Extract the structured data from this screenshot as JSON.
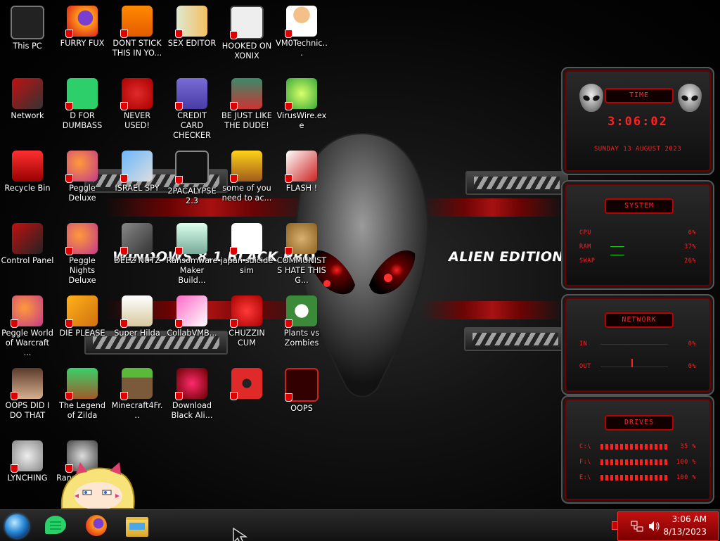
{
  "desktop": {
    "wallpaper_text_left": "WINDOWS 8.1 BLACK PRO",
    "wallpaper_text_right": "ALIEN EDITION 20",
    "icons": [
      {
        "label": "This PC",
        "icon": "monitor-icon"
      },
      {
        "label": "FURRY FUX",
        "icon": "firefox-icon"
      },
      {
        "label": "DONT STICK THIS IN YO...",
        "icon": "vlc-cone-icon"
      },
      {
        "label": "SEX EDITOR",
        "icon": "hex-editor-icon"
      },
      {
        "label": "HOOKED ON XONIX",
        "icon": "xonix-game-icon"
      },
      {
        "label": "VM0Technic...",
        "icon": "doctor-person-icon"
      },
      {
        "label": "Network",
        "icon": "network-icon"
      },
      {
        "label": "D FOR DUMBASS",
        "icon": "green-chat-icon"
      },
      {
        "label": "NEVER USED!",
        "icon": "dev-cpp-icon"
      },
      {
        "label": "CREDIT CARD CHECKER",
        "icon": "credit-card-icon"
      },
      {
        "label": "BE JUST LIKE THE DUDE!",
        "icon": "elf-character-icon"
      },
      {
        "label": "VirusWire.exe",
        "icon": "lime-icon"
      },
      {
        "label": "Recycle Bin",
        "icon": "recycle-bin-icon"
      },
      {
        "label": "Peggle Deluxe",
        "icon": "peggle-icon"
      },
      {
        "label": "ISRAEL SPY",
        "icon": "network-spy-icon"
      },
      {
        "label": "2PACALYPSE 2.3",
        "icon": "terminal-icon"
      },
      {
        "label": "some of you need to ac...",
        "icon": "cartoon-dog-icon"
      },
      {
        "label": "FLASH !",
        "icon": "flash-document-icon"
      },
      {
        "label": "Control Panel",
        "icon": "control-panel-icon"
      },
      {
        "label": "Peggle Nights Deluxe",
        "icon": "peggle-icon"
      },
      {
        "label": "DEEZ NUTZ",
        "icon": "stacked-windows-icon"
      },
      {
        "label": "Ransomware Maker Build...",
        "icon": "app-window-icon"
      },
      {
        "label": "japan suicide sim",
        "icon": "document-icon"
      },
      {
        "label": "COMMUNISTS HATE THIS G...",
        "icon": "money-bag-icon"
      },
      {
        "label": "Peggle World of Warcraft ...",
        "icon": "peggle-icon"
      },
      {
        "label": "DIE PLEASE",
        "icon": "de-app-icon"
      },
      {
        "label": "Super Hilda",
        "icon": "pixel-character-icon"
      },
      {
        "label": "CollabVMB...",
        "icon": "pink-window-icon"
      },
      {
        "label": "CHUZZIN CUM",
        "icon": "red-chuzzle-icon"
      },
      {
        "label": "Plants vs Zombies",
        "icon": "flower-icon"
      },
      {
        "label": "OOPS DID I DO THAT",
        "icon": "portrait-painting-icon"
      },
      {
        "label": "The Legend of Zilda",
        "icon": "pixel-hero-icon"
      },
      {
        "label": "Minecraft4Fr...",
        "icon": "grass-block-icon"
      },
      {
        "label": "Download Black Ali...",
        "icon": "alien-red-icon"
      },
      {
        "label": "",
        "icon": "radiation-icon"
      },
      {
        "label": "OOPS",
        "icon": "red-frame-icon"
      },
      {
        "label": "LYNCHING",
        "icon": "gear-bot-icon"
      },
      {
        "label": "RansomWar...",
        "icon": "skull-icon"
      }
    ]
  },
  "gadgets": {
    "time": {
      "title": "TIME",
      "clock": "3:06:02",
      "date": "SUNDAY 13 AUGUST 2023"
    },
    "system": {
      "title": "SYSTEM",
      "rows": [
        {
          "label": "CPU",
          "value": "6%"
        },
        {
          "label": "RAM",
          "value": "37%"
        },
        {
          "label": "SWAP",
          "value": "26%"
        }
      ]
    },
    "network": {
      "title": "NETWORK",
      "rows": [
        {
          "label": "IN",
          "value": "0%"
        },
        {
          "label": "OUT",
          "value": "0%"
        }
      ]
    },
    "drives": {
      "title": "DRIVES",
      "rows": [
        {
          "label": "C:\\",
          "value": "35 %"
        },
        {
          "label": "F:\\",
          "value": "100 %"
        },
        {
          "label": "E:\\",
          "value": "100 %"
        }
      ]
    }
  },
  "taskbar": {
    "pinned": [
      {
        "name": "start-orb",
        "icon": "start-orb-icon"
      },
      {
        "name": "chat-app",
        "icon": "green-chat-icon"
      },
      {
        "name": "firefox",
        "icon": "firefox-icon"
      },
      {
        "name": "file-explorer",
        "icon": "folder-icon"
      }
    ],
    "clock_time": "3:06 AM",
    "clock_date": "8/13/2023"
  },
  "colors": {
    "accent": "#d01010",
    "tray_bg": "#b01010",
    "text": "#ffffff"
  }
}
